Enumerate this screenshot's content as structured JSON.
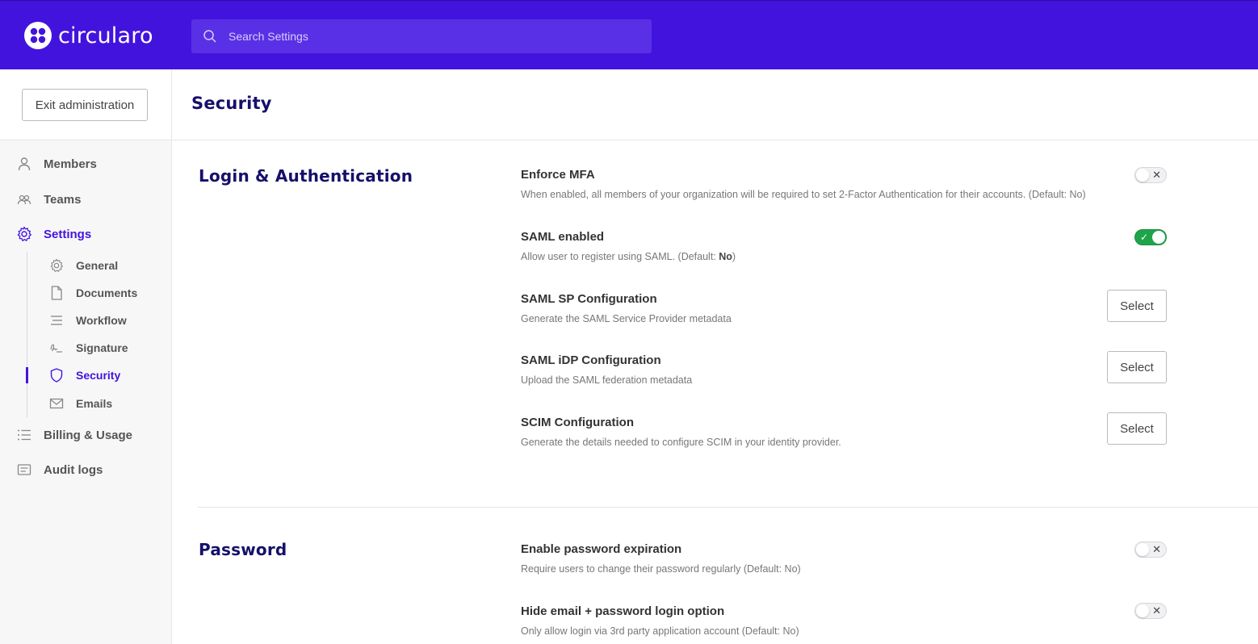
{
  "app": {
    "brand": "circularo",
    "search_placeholder": "Search Settings"
  },
  "sidebar": {
    "exit_label": "Exit administration",
    "items": [
      {
        "label": "Members",
        "icon": "user-icon"
      },
      {
        "label": "Teams",
        "icon": "team-icon"
      },
      {
        "label": "Settings",
        "icon": "gear-icon",
        "active": true
      },
      {
        "label": "Billing & Usage",
        "icon": "list-icon"
      },
      {
        "label": "Audit logs",
        "icon": "log-icon"
      }
    ],
    "sub_items": [
      {
        "label": "General",
        "icon": "gear-icon"
      },
      {
        "label": "Documents",
        "icon": "document-icon"
      },
      {
        "label": "Workflow",
        "icon": "workflow-icon"
      },
      {
        "label": "Signature",
        "icon": "signature-icon"
      },
      {
        "label": "Security",
        "icon": "shield-icon",
        "active": true
      },
      {
        "label": "Emails",
        "icon": "envelope-icon"
      }
    ]
  },
  "main": {
    "title": "Security",
    "sections": [
      {
        "title": "Login & Authentication",
        "settings": [
          {
            "title": "Enforce MFA",
            "desc": "When enabled, all members of your organization will be required to set 2-Factor Authentication for their accounts.  (Default: No)",
            "control": "toggle",
            "on": false
          },
          {
            "title": "SAML enabled",
            "desc_prefix": "Allow user to register using SAML.  (Default: ",
            "desc_bold": "No",
            "desc_suffix": ")",
            "control": "toggle",
            "on": true
          },
          {
            "title": "SAML SP Configuration",
            "desc": "Generate the SAML Service Provider metadata",
            "control": "button",
            "button_label": "Select"
          },
          {
            "title": "SAML iDP Configuration",
            "desc": "Upload the SAML federation metadata",
            "control": "button",
            "button_label": "Select"
          },
          {
            "title": "SCIM Configuration",
            "desc": "Generate the details needed to configure SCIM in your identity provider.",
            "control": "button",
            "button_label": "Select"
          }
        ]
      },
      {
        "title": "Password",
        "settings": [
          {
            "title": "Enable password expiration",
            "desc": "Require users to change their password regularly  (Default: No)",
            "control": "toggle",
            "on": false
          },
          {
            "title": "Hide email + password login option",
            "desc": "Only allow login via 3rd party application account  (Default: No)",
            "control": "toggle",
            "on": false
          }
        ]
      }
    ]
  },
  "colors": {
    "brand": "#4313de",
    "title": "#15106a",
    "toggle_on": "#1ea54a"
  }
}
